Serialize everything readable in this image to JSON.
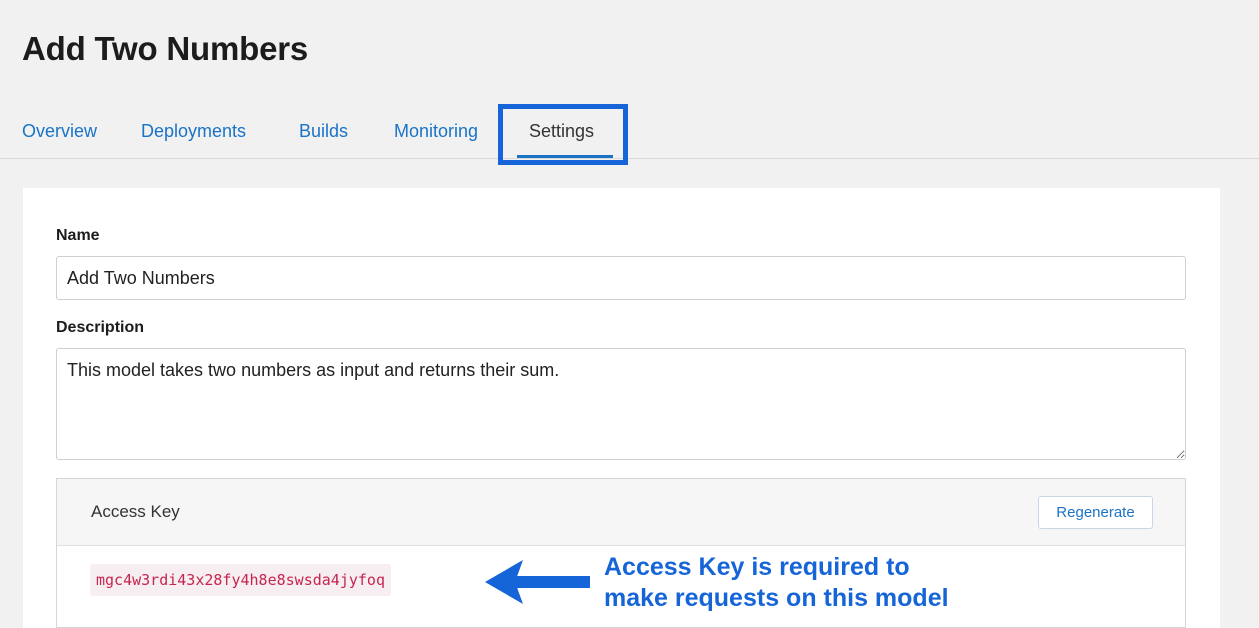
{
  "page": {
    "title": "Add Two Numbers"
  },
  "tabs": [
    {
      "label": "Overview",
      "active": false
    },
    {
      "label": "Deployments",
      "active": false
    },
    {
      "label": "Builds",
      "active": false
    },
    {
      "label": "Monitoring",
      "active": false
    },
    {
      "label": "Settings",
      "active": true
    }
  ],
  "form": {
    "name_label": "Name",
    "name_value": "Add Two Numbers",
    "description_label": "Description",
    "description_value": "This model takes two numbers as input and returns their sum."
  },
  "access_key": {
    "title": "Access Key",
    "regenerate_label": "Regenerate",
    "value": "mgc4w3rdi43x28fy4h8e8swsda4jyfoq"
  },
  "annotation": {
    "line1": "Access Key is required to",
    "line2": "make requests on this model"
  },
  "colors": {
    "accent": "#1a73c7",
    "annotation": "#1565d8",
    "code_text": "#c7254e"
  }
}
